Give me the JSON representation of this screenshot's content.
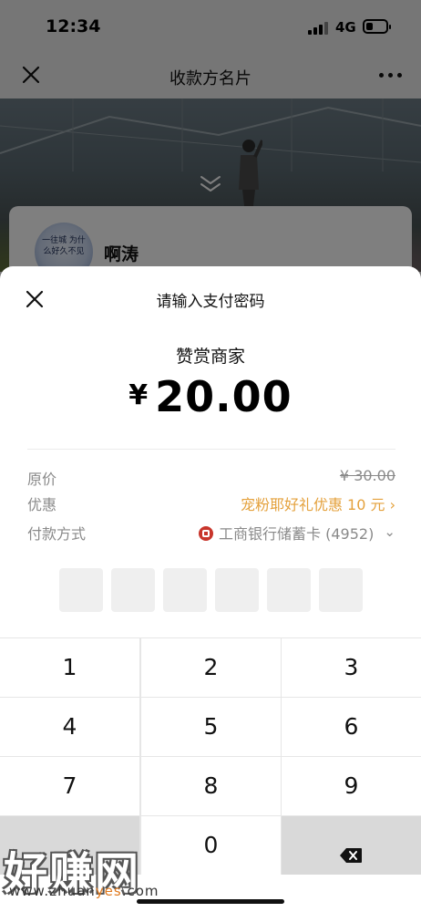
{
  "status_bar": {
    "time": "12:34",
    "network": "4G",
    "icons": [
      "signal-icon",
      "battery-icon"
    ]
  },
  "nav": {
    "title": "收款方名片",
    "close_icon": "close-icon",
    "more_icon": "more-icon"
  },
  "profile": {
    "name": "啊涛",
    "avatar_text": "一往城 为什么好久不见"
  },
  "sheet": {
    "title": "请输入支付密码",
    "merchant": "赞赏商家",
    "currency": "¥",
    "amount": "20.00",
    "rows": {
      "original_label": "原价",
      "original_value": "¥ 30.00",
      "discount_label": "优惠",
      "discount_value": "宠粉耶好礼优惠 10 元 ›",
      "method_label": "付款方式",
      "method_value": "工商银行储蓄卡 (4952)",
      "method_chevron": "⌄"
    },
    "pin_length": 6
  },
  "keypad": {
    "keys": [
      "1",
      "2",
      "3",
      "4",
      "5",
      "6",
      "7",
      "8",
      "9",
      "0"
    ],
    "delete_icon": "backspace-icon"
  },
  "watermark": {
    "title": "好赚网",
    "url_a": "www.zhuan",
    "url_b": "yes",
    "url_c": ".com"
  },
  "colors": {
    "promo": "#e4a13c",
    "bank": "#c8352b",
    "overlay": "rgba(0,0,0,0.5)"
  }
}
